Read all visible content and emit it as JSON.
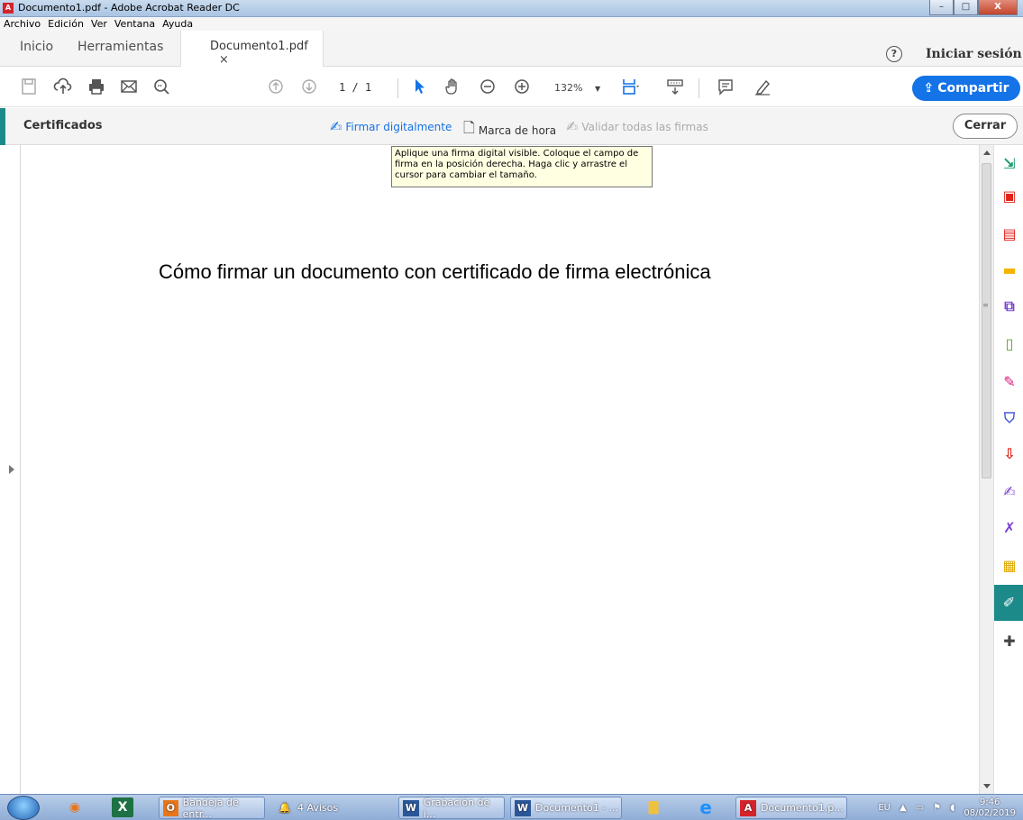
{
  "window": {
    "title": "Documento1.pdf - Adobe Acrobat Reader DC",
    "controls": {
      "minimize": "–",
      "maximize": "□",
      "close": "X"
    }
  },
  "menu": [
    "Archivo",
    "Edición",
    "Ver",
    "Ventana",
    "Ayuda"
  ],
  "tabs": {
    "home": "Inicio",
    "tools": "Herramientas",
    "document": "Documento1.pdf",
    "close_symbol": "×"
  },
  "header": {
    "help_symbol": "?",
    "signin": "Iniciar sesión"
  },
  "toolbar": {
    "page_current": "1",
    "page_total": "/ 1",
    "zoom": "132%",
    "share_label": "Compartir"
  },
  "certificates": {
    "title": "Certificados",
    "sign_digitally": "Firmar digitalmente",
    "timestamp": "Marca de hora",
    "validate_all": "Validar todas las firmas",
    "close": "Cerrar",
    "tooltip": "Aplique una firma digital visible. Coloque el campo de firma en la posición derecha. Haga clic y arrastre el cursor para cambiar el tamaño."
  },
  "document": {
    "heading": "Cómo firmar un documento con certificado de firma electrónica"
  },
  "right_tools": [
    {
      "name": "export-pdf-icon",
      "glyph": "⇲",
      "color": "#1a9a6b"
    },
    {
      "name": "create-pdf-icon",
      "glyph": "▣",
      "color": "#e2231a"
    },
    {
      "name": "organize-pages-icon",
      "glyph": "▤",
      "color": "#e2231a"
    },
    {
      "name": "comment-icon",
      "glyph": "▬",
      "color": "#f5b300"
    },
    {
      "name": "combine-files-icon",
      "glyph": "⧉",
      "color": "#7a3fd1"
    },
    {
      "name": "edit-pdf-icon",
      "glyph": "▯",
      "color": "#5aa51c"
    },
    {
      "name": "fill-sign-icon",
      "glyph": "✎",
      "color": "#d8167d"
    },
    {
      "name": "protect-icon",
      "glyph": "⛉",
      "color": "#4a5bd6"
    },
    {
      "name": "export-icon",
      "glyph": "⇩",
      "color": "#e2231a"
    },
    {
      "name": "signature-icon",
      "glyph": "✍",
      "color": "#7a3fd1"
    },
    {
      "name": "send-for-signature-icon",
      "glyph": "✗",
      "color": "#7a3fd1"
    },
    {
      "name": "send-track-icon",
      "glyph": "▦",
      "color": "#e0a800"
    },
    {
      "name": "certificates-icon",
      "glyph": "✐",
      "color": "#ffffff"
    },
    {
      "name": "more-tools-icon",
      "glyph": "✚",
      "color": "#444444"
    }
  ],
  "taskbar": {
    "items": [
      {
        "label": "Bandeja de entr...",
        "icon": "O"
      },
      {
        "label": "4 Avisos",
        "icon": "🔔"
      },
      {
        "label": "Grabación de i...",
        "icon": "W"
      },
      {
        "label": "Documento1 - ...",
        "icon": "W"
      },
      {
        "label": "Documento1.p...",
        "icon": "A"
      }
    ],
    "lang": "EU",
    "time": "9:46",
    "date": "08/02/2019"
  }
}
